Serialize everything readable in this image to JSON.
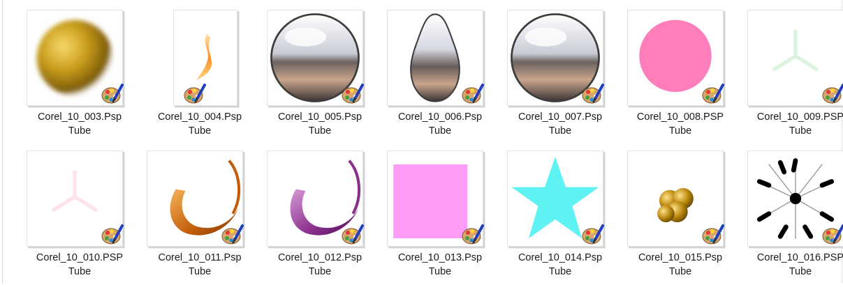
{
  "files": [
    {
      "name": "Corel_10_003.Psp",
      "type": "Tube",
      "icon": "gold-sphere-icon"
    },
    {
      "name": "Corel_10_004.Psp",
      "type": "Tube",
      "icon": "flame-icon"
    },
    {
      "name": "Corel_10_005.Psp",
      "type": "Tube",
      "icon": "chrome-sphere-icon"
    },
    {
      "name": "Corel_10_006.Psp",
      "type": "Tube",
      "icon": "chrome-drop-icon"
    },
    {
      "name": "Corel_10_007.Psp",
      "type": "Tube",
      "icon": "chrome-sphere-icon"
    },
    {
      "name": "Corel_10_008.PSP",
      "type": "Tube",
      "icon": "pink-circle-icon"
    },
    {
      "name": "Corel_10_009.PSP",
      "type": "Tube",
      "icon": "faint-green-tripod-icon"
    },
    {
      "name": "Corel_10_010.PSP",
      "type": "Tube",
      "icon": "faint-pink-tripod-icon"
    },
    {
      "name": "Corel_10_011.Psp",
      "type": "Tube",
      "icon": "orange-swirl-icon"
    },
    {
      "name": "Corel_10_012.Psp",
      "type": "Tube",
      "icon": "purple-swirl-icon"
    },
    {
      "name": "Corel_10_013.Psp",
      "type": "Tube",
      "icon": "pink-square-icon"
    },
    {
      "name": "Corel_10_014.Psp",
      "type": "Tube",
      "icon": "cyan-star-icon"
    },
    {
      "name": "Corel_10_015.Psp",
      "type": "Tube",
      "icon": "gold-balls-icon"
    },
    {
      "name": "Corel_10_016.PSP",
      "type": "Tube",
      "icon": "black-burst-icon"
    }
  ],
  "badge_icon": "paint-palette-icon",
  "colors": {
    "pink": "#ff7db8",
    "light_pink": "#ff9cf6",
    "cyan": "#5ef2f2",
    "gold": "#c69a18"
  }
}
